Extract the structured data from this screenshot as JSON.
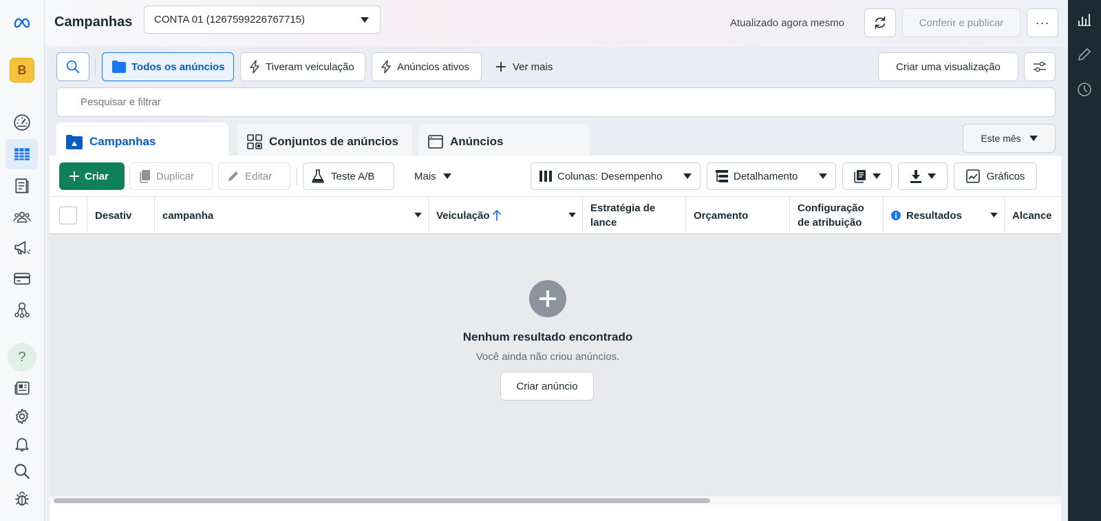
{
  "header": {
    "title": "Campanhas",
    "account": "CONTA 01 (1267599226767715)",
    "updated": "Atualizado agora mesmo",
    "publish_label": "Conferir e publicar",
    "more_label": "···"
  },
  "leftnav": {
    "brand_letter": "B",
    "help_symbol": "?",
    "items": [
      "meta-logo-icon",
      "business-avatar",
      "dashboard-gauge-icon",
      "ads-manager-table-icon",
      "pages-icon",
      "audiences-icon",
      "campaign-megaphone-icon",
      "billing-card-icon",
      "events-manager-icon",
      "help-icon",
      "news-icon",
      "settings-gear-icon",
      "notifications-bell-icon",
      "search-icon",
      "bug-report-icon"
    ]
  },
  "rightpanel": {
    "items": [
      "bar-chart-icon",
      "edit-pencil-icon",
      "history-clock-icon"
    ]
  },
  "filters": {
    "all_ads": "Todos os anúncios",
    "delivered": "Tiveram veiculação",
    "active_ads": "Anúncios ativos",
    "see_more": "Ver mais",
    "create_view": "Criar uma visualização"
  },
  "search": {
    "placeholder": "Pesquisar e filtrar"
  },
  "tabs": [
    {
      "label": "Campanhas"
    },
    {
      "label": "Conjuntos de anúncios"
    },
    {
      "label": "Anúncios"
    }
  ],
  "date_range": "Este mês",
  "toolbar": {
    "create": "Criar",
    "duplicate": "Duplicar",
    "edit": "Editar",
    "ab_test": "Teste A/B",
    "more": "Mais",
    "columns": "Colunas: Desempenho",
    "breakdown": "Detalhamento",
    "charts": "Gráficos"
  },
  "table": {
    "columns": [
      "Desativ",
      "campanha",
      "Veiculação",
      "Estratégia de lance",
      "Orçamento",
      "Configuração de atribuição",
      "Resultados",
      "Alcance"
    ]
  },
  "empty_state": {
    "title": "Nenhum resultado encontrado",
    "subtitle": "Você ainda não criou anúncios.",
    "button": "Criar anúncio"
  },
  "colors": {
    "primary_blue": "#0a5cc2",
    "create_green": "#10805a",
    "nav_dark": "#1c2b33",
    "brand_yellow": "#f5c33b"
  }
}
